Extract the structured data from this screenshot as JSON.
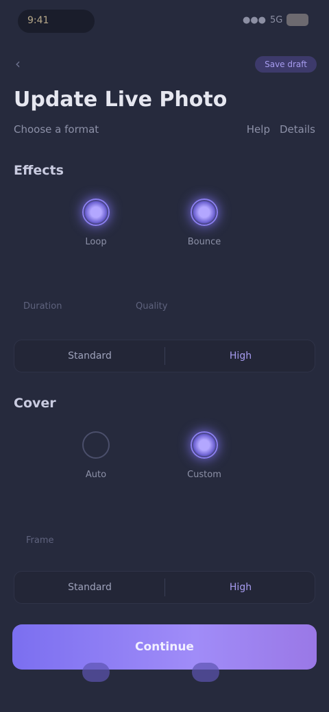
{
  "status": {
    "time": "9:41",
    "signal": "●●●",
    "network": "5G"
  },
  "header": {
    "back": "‹",
    "link_label": "Save draft"
  },
  "page": {
    "title": "Update Live Photo",
    "subtitle_left": "Choose a format",
    "subtitle_right": [
      "Help",
      "Details"
    ]
  },
  "section1": {
    "title": "Effects",
    "options": [
      {
        "label": "Loop",
        "selected": true
      },
      {
        "label": "Bounce",
        "selected": true
      }
    ],
    "fields": [
      "Duration",
      "Quality"
    ],
    "segments": [
      "Standard",
      "High"
    ],
    "active_segment": 1
  },
  "section2": {
    "title": "Cover",
    "options": [
      {
        "label": "Auto",
        "selected": false
      },
      {
        "label": "Custom",
        "selected": true
      }
    ],
    "fields": [
      "Frame"
    ],
    "segments": [
      "Standard",
      "High"
    ],
    "active_segment": 1
  },
  "actions": {
    "primary": "Continue"
  },
  "colors": {
    "accent": "#8b7ff0",
    "background": "#262a3d"
  }
}
